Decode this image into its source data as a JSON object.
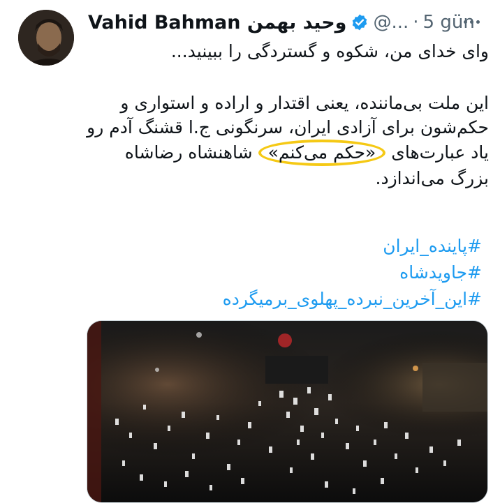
{
  "tweet": {
    "author_name": "Vahid Bahman وحید بهمن",
    "handle": "@...",
    "separator": "·",
    "time": "5 gün",
    "line1": "وای خدای من، شکوه و گستردگی را ببینید...",
    "para_a": "این ملت بی‌ماننده، یعنی اقتدار و اراده و استواری و حکم‌شون برای آزادی ایران، سرنگونی ج.ا قشنگ آدم رو یاد عبارت‌های",
    "para_highlight": "«حکم می‌کنم»",
    "para_b": "شاهنشاه رضاشاه بزرگ می‌اندازد.",
    "hashtags": [
      "#پاینده_ایران",
      "#جاویدشاه",
      "#این_آخرین_نبرده_پهلوی_برمیگرده"
    ]
  },
  "icons": {
    "verified": "verified-badge-icon",
    "more": "more-options-icon"
  },
  "colors": {
    "link": "#1d9bf0",
    "verified": "#1d9bf0",
    "muted": "#536471",
    "highlight": "#f5c915"
  }
}
